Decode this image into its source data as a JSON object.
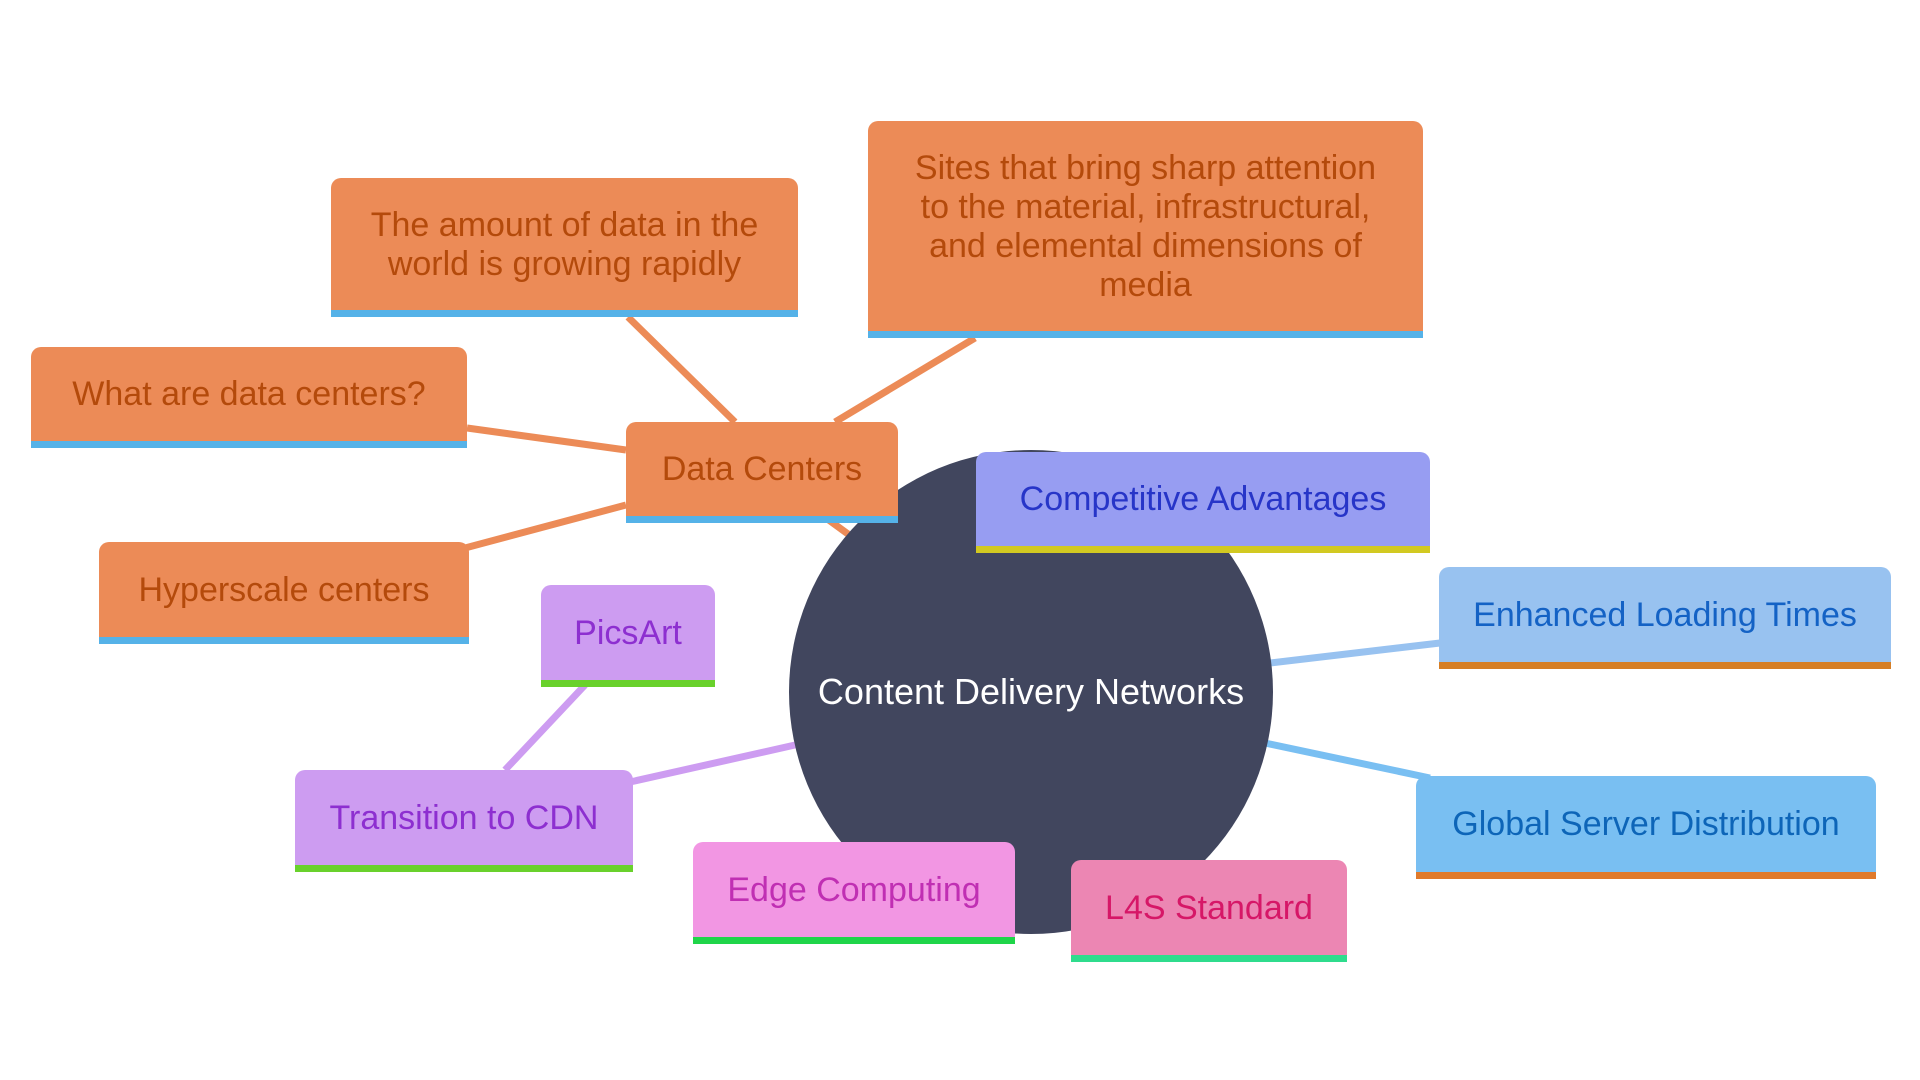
{
  "diagram": {
    "type": "mindmap",
    "root": {
      "label": "Content Delivery Networks",
      "color": "#41465e"
    },
    "branches": [
      {
        "id": "data-centers",
        "label": "Data Centers",
        "color": "#ec8b57",
        "children": [
          {
            "id": "data-growing",
            "label": "The amount of data in the world is growing rapidly"
          },
          {
            "id": "sites-attention",
            "label": "Sites that bring sharp attention to the material, infrastructural, and elemental dimensions of media"
          },
          {
            "id": "what-are",
            "label": "What are data centers?"
          },
          {
            "id": "hyperscale",
            "label": "Hyperscale centers"
          }
        ]
      },
      {
        "id": "competitive",
        "label": "Competitive Advantages",
        "color": "#979df2",
        "children": []
      },
      {
        "id": "enhanced",
        "label": "Enhanced Loading Times",
        "color": "#98c2f0",
        "children": []
      },
      {
        "id": "global",
        "label": "Global Server Distribution",
        "color": "#79bff2",
        "children": []
      },
      {
        "id": "l4s",
        "label": "L4S Standard",
        "color": "#ec86b3",
        "children": []
      },
      {
        "id": "edge",
        "label": "Edge Computing",
        "color": "#f296e3",
        "children": []
      },
      {
        "id": "transition",
        "label": "Transition to CDN",
        "color": "#cd9cf1",
        "children": [
          {
            "id": "picsart",
            "label": "PicsArt"
          }
        ]
      }
    ]
  },
  "edge_colors": {
    "orange": "#ec8b57",
    "purple": "#cd9cf1",
    "sky": "#98c2f0",
    "blue": "#79bff2"
  }
}
